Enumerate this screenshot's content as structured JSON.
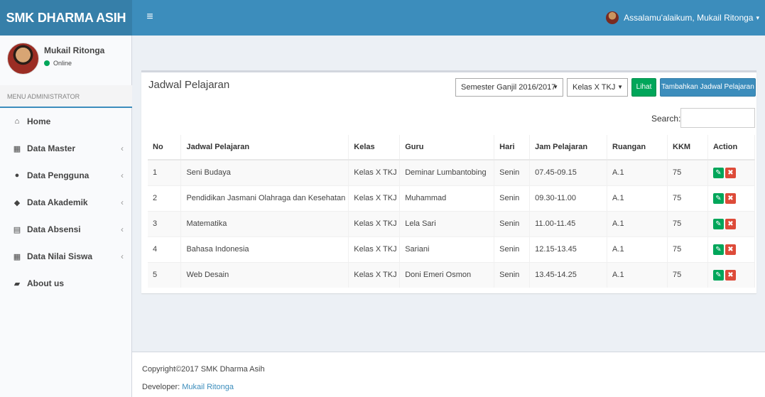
{
  "header": {
    "logo": "SMK DHARMA ASIH",
    "toggle_icon": "≡",
    "greeting": "Assalamu'alaikum, Mukail Ritonga",
    "caret": "▾"
  },
  "sidebar": {
    "user_name": "Mukail Ritonga",
    "user_status": "Online",
    "menu_header": "MENU ADMINISTRATOR",
    "items": [
      {
        "label": "Home",
        "icon": "home-icon",
        "glyph": "⌂",
        "chevron": ""
      },
      {
        "label": "Data Master",
        "icon": "grid-icon",
        "glyph": "▦",
        "chevron": "‹"
      },
      {
        "label": "Data Pengguna",
        "icon": "user-icon",
        "glyph": "●",
        "chevron": "‹"
      },
      {
        "label": "Data Akademik",
        "icon": "tag-icon",
        "glyph": "◆",
        "chevron": "‹"
      },
      {
        "label": "Data Absensi",
        "icon": "calendar-icon",
        "glyph": "▤",
        "chevron": "‹"
      },
      {
        "label": "Data Nilai Siswa",
        "icon": "table-icon",
        "glyph": "▦",
        "chevron": "‹"
      },
      {
        "label": "About us",
        "icon": "book-icon",
        "glyph": "▰",
        "chevron": ""
      }
    ]
  },
  "box": {
    "title": "Jadwal Pelajaran",
    "semester_select": "Semester Ganjil 2016/2017",
    "kelas_select": "Kelas X TKJ",
    "lihat_button": "Lihat",
    "tambah_button": "Tambahkan Jadwal Pelajaran",
    "search_label": "Search:",
    "search_value": ""
  },
  "table": {
    "headers": [
      "No",
      "Jadwal Pelajaran",
      "Kelas",
      "Guru",
      "Hari",
      "Jam Pelajaran",
      "Ruangan",
      "KKM",
      "Action"
    ],
    "rows": [
      [
        "1",
        "Seni Budaya",
        "Kelas X TKJ",
        "Deminar Lumbantobing",
        "Senin",
        "07.45-09.15",
        "A.1",
        "75"
      ],
      [
        "2",
        "Pendidikan Jasmani Olahraga dan Kesehatan",
        "Kelas X TKJ",
        "Muhammad",
        "Senin",
        "09.30-11.00",
        "A.1",
        "75"
      ],
      [
        "3",
        "Matematika",
        "Kelas X TKJ",
        "Lela Sari",
        "Senin",
        "11.00-11.45",
        "A.1",
        "75"
      ],
      [
        "4",
        "Bahasa Indonesia",
        "Kelas X TKJ",
        "Sariani",
        "Senin",
        "12.15-13.45",
        "A.1",
        "75"
      ],
      [
        "5",
        "Web Desain",
        "Kelas X TKJ",
        "Doni Emeri Osmon",
        "Senin",
        "13.45-14.25",
        "A.1",
        "75"
      ]
    ],
    "edit_glyph": "✎",
    "delete_glyph": "✖"
  },
  "footer": {
    "copyright": "Copyright©2017 SMK Dharma Asih",
    "developer_prefix": "Developer: ",
    "developer_name": "Mukail Ritonga"
  },
  "colors": {
    "header": "#3c8dbc",
    "logo_bg": "#367fa9",
    "success": "#00a65a",
    "danger": "#dd4b39"
  }
}
